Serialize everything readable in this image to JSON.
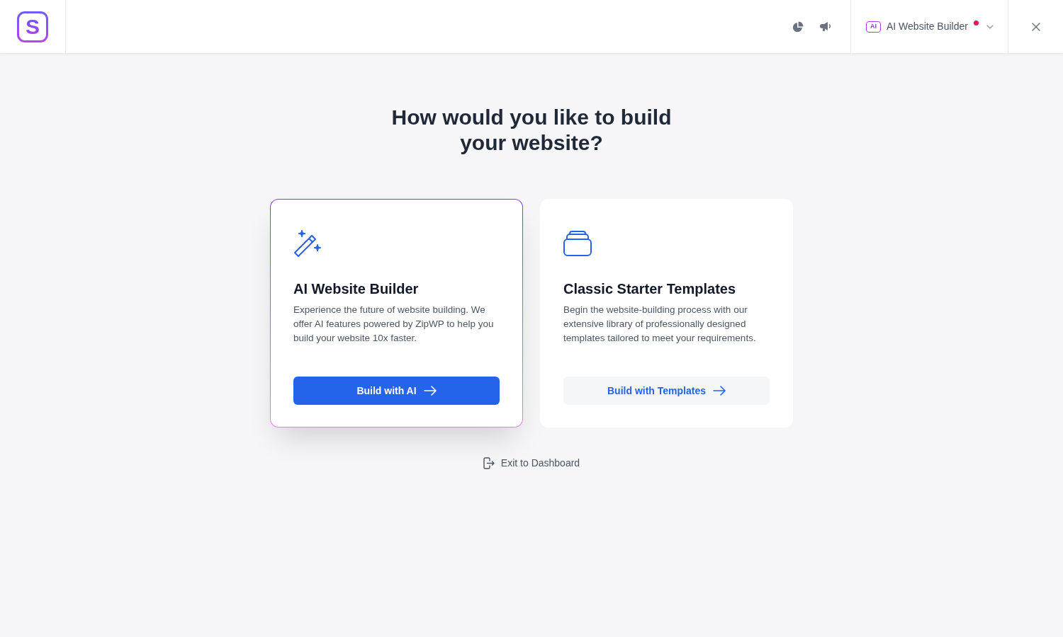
{
  "header": {
    "logo": {
      "letter": "S"
    },
    "mode_selector": {
      "badge": "AI",
      "label": "AI Website Builder",
      "notification": true
    }
  },
  "heading": "How would you like to build your website?",
  "cards": [
    {
      "title": "AI Website Builder",
      "description": "Experience the future of website building. We offer AI features powered by ZipWP to help you build your website 10x faster.",
      "button": "Build with AI",
      "selected": true
    },
    {
      "title": "Classic Starter Templates",
      "description": "Begin the website-building process with our extensive library of professionally designed templates tailored to meet your requirements.",
      "button": "Build with Templates",
      "selected": false
    }
  ],
  "exit_link": "Exit to Dashboard"
}
